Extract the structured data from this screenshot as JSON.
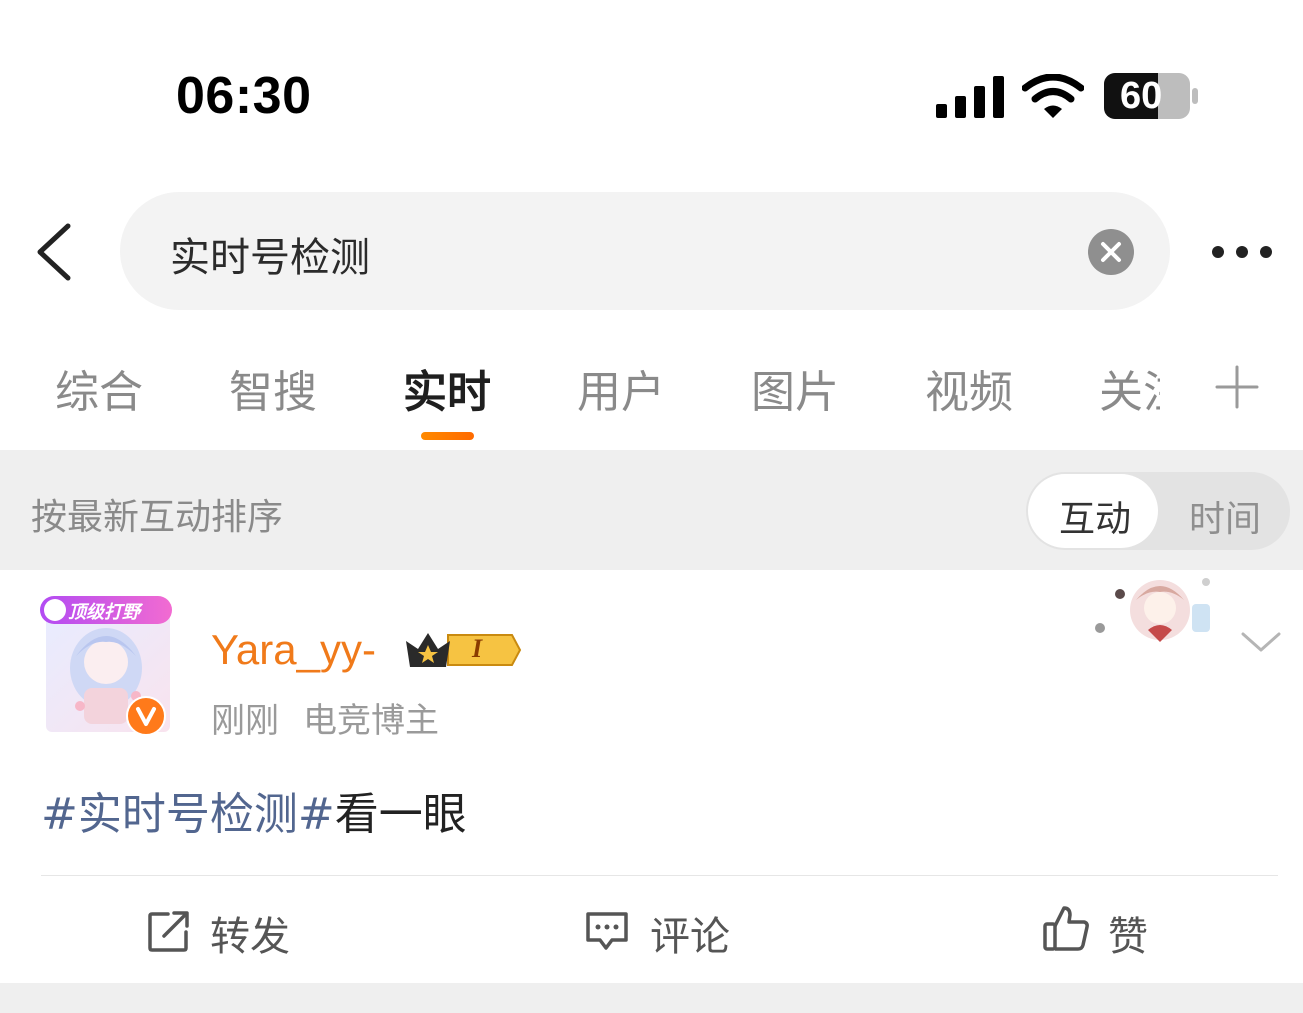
{
  "status_bar": {
    "time": "06:30",
    "battery": "60"
  },
  "search": {
    "query": "实时号检测"
  },
  "tabs": [
    {
      "label": "综合"
    },
    {
      "label": "智搜"
    },
    {
      "label": "实时",
      "active": true
    },
    {
      "label": "用户"
    },
    {
      "label": "图片"
    },
    {
      "label": "视频"
    },
    {
      "label": "关注"
    }
  ],
  "sort": {
    "label": "按最新互动排序",
    "options": [
      "互动",
      "时间"
    ],
    "selected": "互动"
  },
  "post": {
    "username": "Yara_yy-",
    "avatar_badge": "顶级打野",
    "level_badge": "I",
    "time": "刚刚",
    "role": "电竞博主",
    "hashtag": "#实时号检测#",
    "text": "看一眼"
  },
  "actions": {
    "repost": "转发",
    "comment": "评论",
    "like": "赞"
  },
  "colors": {
    "accent": "#ff7a00",
    "username": "#f07a1a",
    "hashtag": "#52668f"
  },
  "icons": [
    "back-arrow-icon",
    "clear-icon",
    "more-icon",
    "add-tab-icon",
    "chevron-down-icon",
    "repost-icon",
    "comment-icon",
    "like-icon",
    "verified-v-icon",
    "crown-icon"
  ]
}
